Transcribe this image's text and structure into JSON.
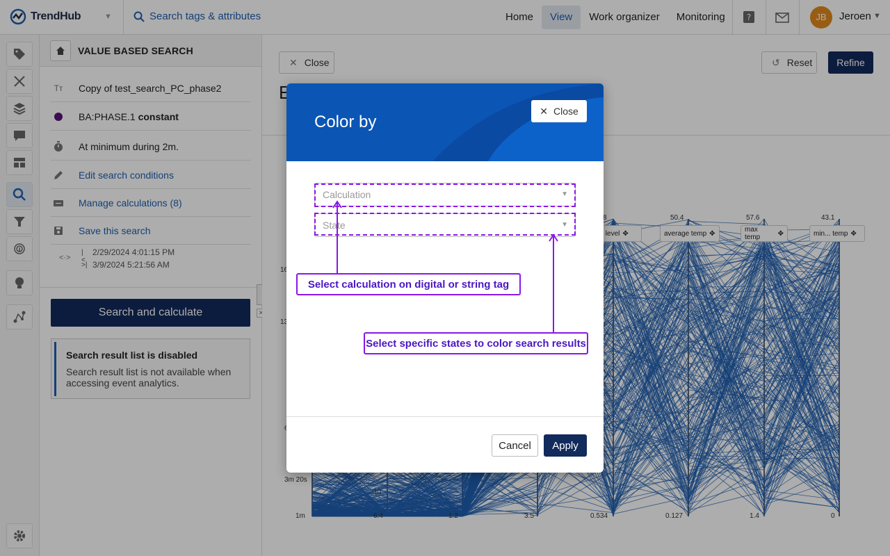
{
  "app": {
    "brand": "TrendHub"
  },
  "topbar": {
    "search_label": "Search tags & attributes",
    "nav": [
      "Home",
      "View",
      "Work organizer",
      "Monitoring"
    ],
    "active_nav": "View",
    "user_initials": "JB",
    "user_name": "Jeroen"
  },
  "panel": {
    "title": "VALUE BASED SEARCH",
    "search_name": "Copy of test_search_PC_phase2",
    "condition_tag": "BA:PHASE.1",
    "condition_value": "constant",
    "duration": "At minimum during 2m.",
    "edit_conditions": "Edit search conditions",
    "manage_calculations": "Manage calculations (8)",
    "save_search": "Save this search",
    "start_date": "2/29/2024 4:01:15 PM",
    "end_date": "3/9/2024 5:21:56 AM",
    "search_button": "Search and calculate",
    "info_title": "Search result list is disabled",
    "info_text": "Search result list is not available when accessing event analytics."
  },
  "main": {
    "close_label": "Close",
    "reset_label": "Reset",
    "refine_label": "Refine",
    "heading_initial": "E",
    "columns": [
      "...age level",
      "average temp",
      "max temp",
      "min... temp"
    ],
    "axis_bottom": [
      "1m",
      "6.4",
      "1.2",
      "3.5",
      "0.534",
      "0.127",
      "1.4",
      "0"
    ],
    "axis_top": [
      "8",
      "50.4",
      "57.6",
      "43.1"
    ],
    "left_ticks": [
      "16",
      "13",
      "6",
      "3m 20s",
      "10"
    ]
  },
  "modal": {
    "title": "Color by",
    "close_label": "Close",
    "calculation_placeholder": "Calculation",
    "state_placeholder": "State",
    "cancel_label": "Cancel",
    "apply_label": "Apply"
  },
  "annotations": {
    "calculation_hint": "Select calculation on digital or string tag",
    "state_hint": "Select specific states to color search results"
  },
  "colors": {
    "brand_navy": "#122a5c",
    "accent_blue": "#1f5fb0",
    "annotation_purple": "#8a17e6",
    "avatar_orange": "#e08a1e",
    "chart_line_blue": "#1f5fb0"
  }
}
